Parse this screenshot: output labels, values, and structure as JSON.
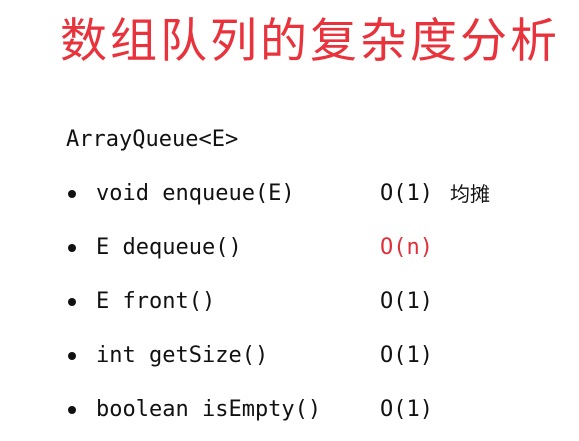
{
  "title": "数组队列的复杂度分析",
  "heading": "ArrayQueue<E>",
  "accent_color": "#e0303a",
  "methods": [
    {
      "signature": "void enqueue(E)",
      "complexity": "O(1)",
      "note": "均摊",
      "highlight": false
    },
    {
      "signature": "E dequeue()",
      "complexity": "O(n)",
      "highlight": true
    },
    {
      "signature": "E front()",
      "complexity": "O(1)",
      "highlight": false
    },
    {
      "signature": "int getSize()",
      "complexity": "O(1)",
      "highlight": false
    },
    {
      "signature": "boolean isEmpty()",
      "complexity": "O(1)",
      "highlight": false
    }
  ]
}
